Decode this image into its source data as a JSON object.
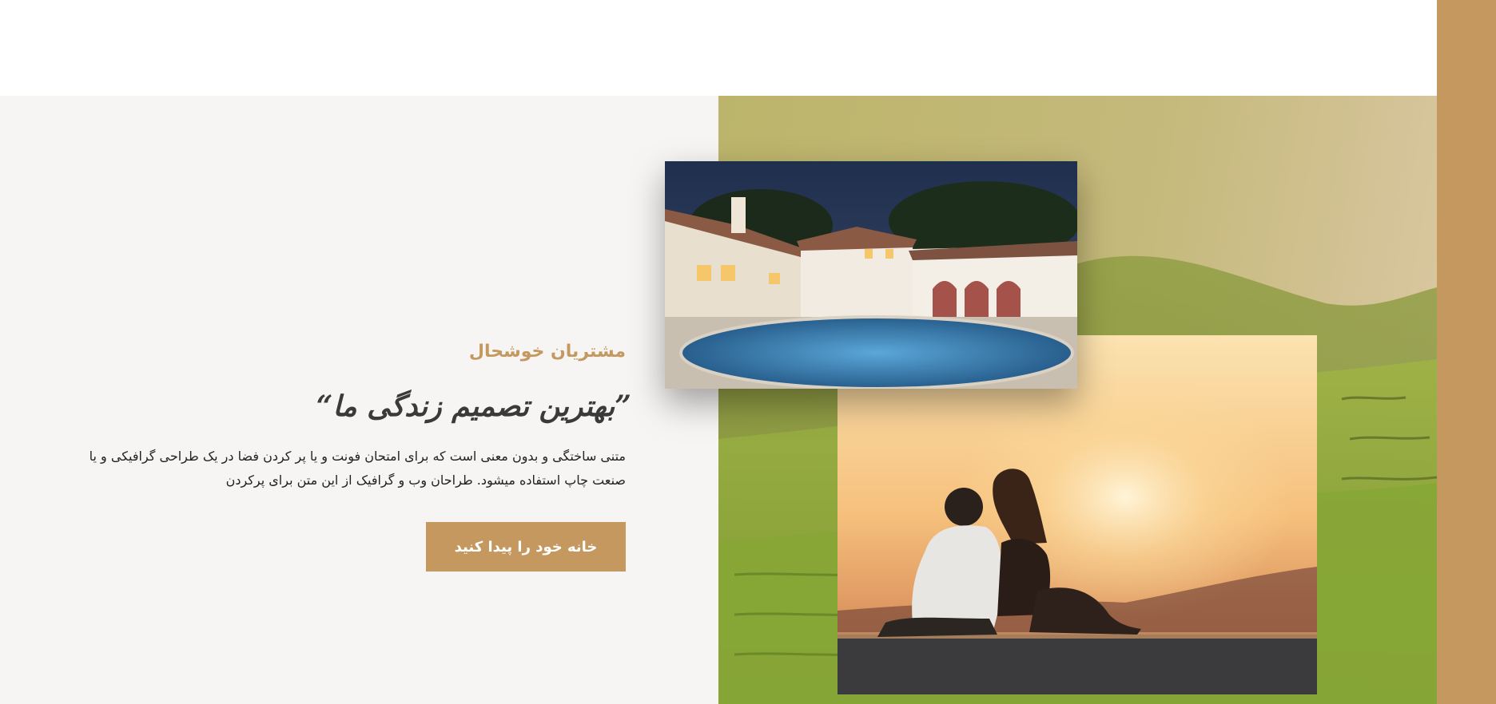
{
  "testimonial": {
    "eyebrow": "مشتریان خوشحال",
    "headline": "”بهترین تصمیم زندگی ما“",
    "body": "متنی ساختگی و بدون معنی است که برای امتحان فونت و یا پر کردن فضا در یک طراحی گرافیکی و یا صنعت چاپ استفاده میشود. طراحان وب و گرافیک از این متن برای پرکردن",
    "cta_label": "خانه خود را پیدا کنید"
  },
  "images": {
    "house": "house-with-pool-at-night",
    "couple": "couple-watching-sunset"
  },
  "colors": {
    "accent": "#c4985f",
    "section_bg": "#f7f5f3",
    "heading": "#3a3a3a",
    "body": "#222222"
  }
}
